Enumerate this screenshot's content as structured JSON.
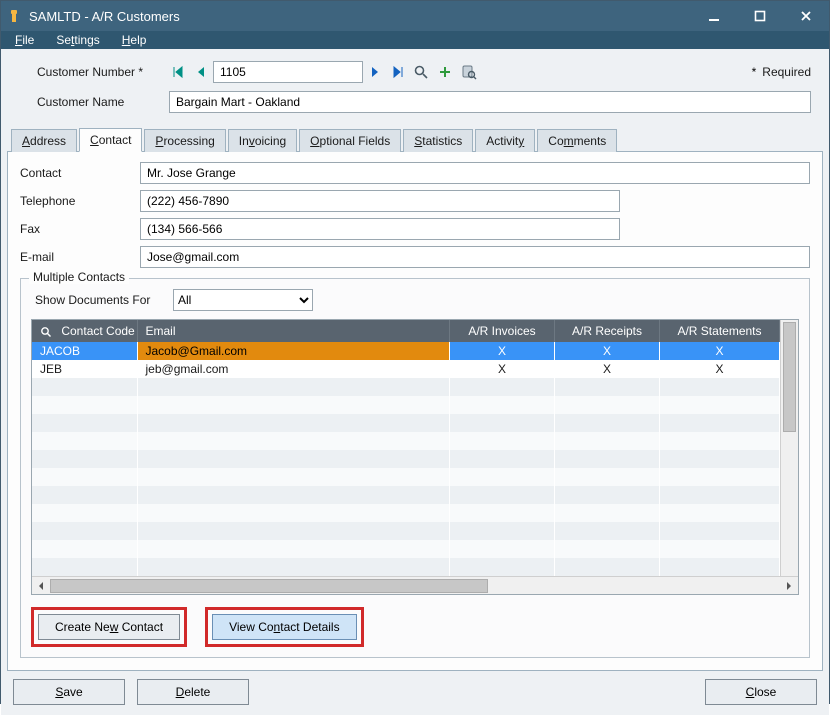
{
  "window": {
    "title": "SAMLTD - A/R Customers"
  },
  "menu": {
    "file": "File",
    "settings": "Settings",
    "help": "Help"
  },
  "upper": {
    "customer_number_label": "Customer Number *",
    "customer_number_value": "1105",
    "customer_name_label": "Customer Name",
    "customer_name_value": "Bargain Mart - Oakland",
    "required_label": "Required"
  },
  "tabs": {
    "address": "Address",
    "contact": "Contact",
    "processing": "Processing",
    "invoicing": "Invoicing",
    "optional_fields": "Optional Fields",
    "statistics": "Statistics",
    "activity": "Activity",
    "comments": "Comments"
  },
  "contact_tab": {
    "contact_label": "Contact",
    "contact_value": "Mr. Jose Grange",
    "telephone_label": "Telephone",
    "telephone_value": "(222) 456-7890",
    "fax_label": "Fax",
    "fax_value": "(134) 566-566",
    "email_label": "E-mail",
    "email_value": "Jose@gmail.com"
  },
  "multiple_contacts": {
    "legend": "Multiple Contacts",
    "show_docs_label": "Show Documents For",
    "show_docs_value": "All",
    "columns": {
      "code": "Contact Code",
      "email": "Email",
      "ar_invoices": "A/R Invoices",
      "ar_receipts": "A/R Receipts",
      "ar_statements": "A/R Statements"
    },
    "rows": [
      {
        "code": "JACOB",
        "email": "Jacob@Gmail.com",
        "inv": "X",
        "rec": "X",
        "stmt": "X",
        "selected": true
      },
      {
        "code": "JEB",
        "email": "jeb@gmail.com",
        "inv": "X",
        "rec": "X",
        "stmt": "X",
        "selected": false
      }
    ]
  },
  "buttons": {
    "create_new_contact": "Create New Contact",
    "view_contact_details": "View Contact Details",
    "save": "Save",
    "delete": "Delete",
    "close": "Close"
  }
}
